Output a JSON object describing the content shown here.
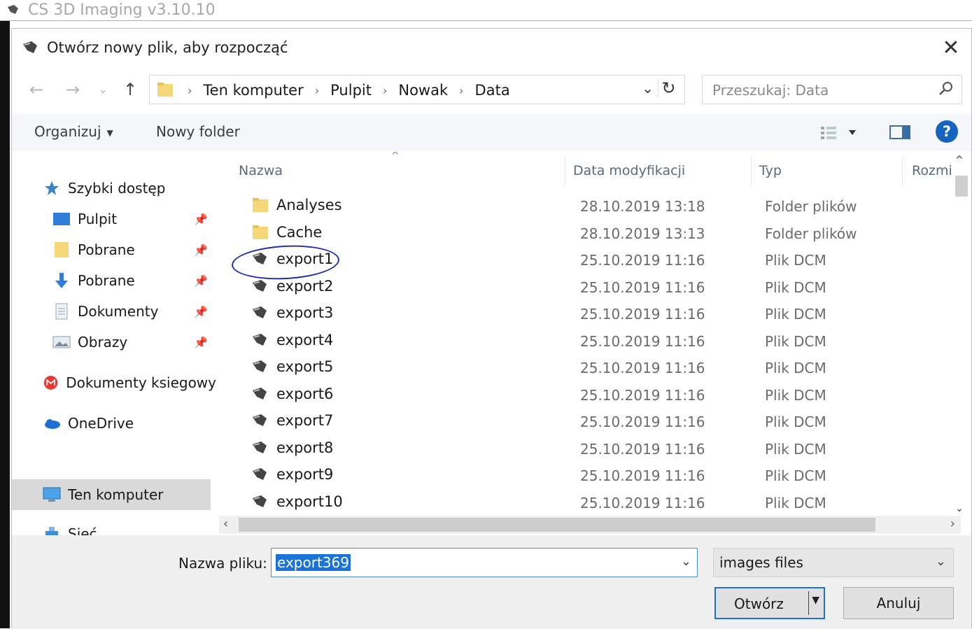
{
  "background_window": {
    "title": "CS 3D Imaging v3.10.10"
  },
  "dialog": {
    "title": "Otwórz nowy plik, aby rozpocząć",
    "close_glyph": "✕"
  },
  "nav": {
    "back": "←",
    "forward": "→",
    "recent": "⌄",
    "up": "↑",
    "breadcrumbs": [
      "Ten komputer",
      "Pulpit",
      "Nowak",
      "Data"
    ],
    "separator": "›",
    "dropdown": "⌄",
    "refresh": "↻",
    "search_placeholder": "Przeszukaj: Data"
  },
  "toolbar": {
    "organize": "Organizuj",
    "organize_caret": "▼",
    "new_folder": "Nowy folder",
    "help": "?"
  },
  "sidebar": {
    "items": [
      {
        "label": "Szybki dostęp",
        "icon": "star-icon"
      },
      {
        "label": "Pulpit",
        "icon": "desktop-icon",
        "pinned": true
      },
      {
        "label": "Pobrane",
        "icon": "folder-icon",
        "pinned": true
      },
      {
        "label": "Pobrane",
        "icon": "download-icon",
        "pinned": true
      },
      {
        "label": "Dokumenty",
        "icon": "document-icon",
        "pinned": true
      },
      {
        "label": "Obrazy",
        "icon": "pictures-icon",
        "pinned": true
      },
      {
        "label": "Dokumenty ksiegowy",
        "icon": "m-logo-icon"
      },
      {
        "label": "OneDrive",
        "icon": "cloud-icon"
      },
      {
        "label": "Ten komputer",
        "icon": "computer-icon",
        "selected": true
      },
      {
        "label": "Sieć",
        "icon": "network-icon"
      }
    ],
    "pin_glyph": "📌"
  },
  "columns": {
    "name": "Nazwa",
    "date": "Data modyfikacji",
    "type": "Typ",
    "size": "Rozmi",
    "sort_glyph": "^"
  },
  "files": [
    {
      "name": "Analyses",
      "date": "28.10.2019 13:18",
      "type": "Folder plików",
      "kind": "folder"
    },
    {
      "name": "Cache",
      "date": "28.10.2019 13:13",
      "type": "Folder plików",
      "kind": "folder"
    },
    {
      "name": "export1",
      "date": "25.10.2019 11:16",
      "type": "Plik DCM",
      "kind": "dcm"
    },
    {
      "name": "export2",
      "date": "25.10.2019 11:16",
      "type": "Plik DCM",
      "kind": "dcm"
    },
    {
      "name": "export3",
      "date": "25.10.2019 11:16",
      "type": "Plik DCM",
      "kind": "dcm"
    },
    {
      "name": "export4",
      "date": "25.10.2019 11:16",
      "type": "Plik DCM",
      "kind": "dcm"
    },
    {
      "name": "export5",
      "date": "25.10.2019 11:16",
      "type": "Plik DCM",
      "kind": "dcm"
    },
    {
      "name": "export6",
      "date": "25.10.2019 11:16",
      "type": "Plik DCM",
      "kind": "dcm"
    },
    {
      "name": "export7",
      "date": "25.10.2019 11:16",
      "type": "Plik DCM",
      "kind": "dcm"
    },
    {
      "name": "export8",
      "date": "25.10.2019 11:16",
      "type": "Plik DCM",
      "kind": "dcm"
    },
    {
      "name": "export9",
      "date": "25.10.2019 11:16",
      "type": "Plik DCM",
      "kind": "dcm"
    },
    {
      "name": "export10",
      "date": "25.10.2019 11:16",
      "type": "Plik DCM",
      "kind": "dcm"
    }
  ],
  "bottom": {
    "filename_label": "Nazwa pliku:",
    "filename_value": "export369",
    "filetype_value": "images files",
    "dropdown": "⌄",
    "open_label": "Otwórz",
    "open_caret": "▼",
    "cancel_label": "Anuluj"
  },
  "scroll": {
    "up": "^",
    "down": "⌄",
    "left": "‹",
    "right": "›"
  },
  "colors": {
    "accent": "#1a73d9",
    "annotation": "#1f2fa8",
    "help": "#1565c0"
  }
}
